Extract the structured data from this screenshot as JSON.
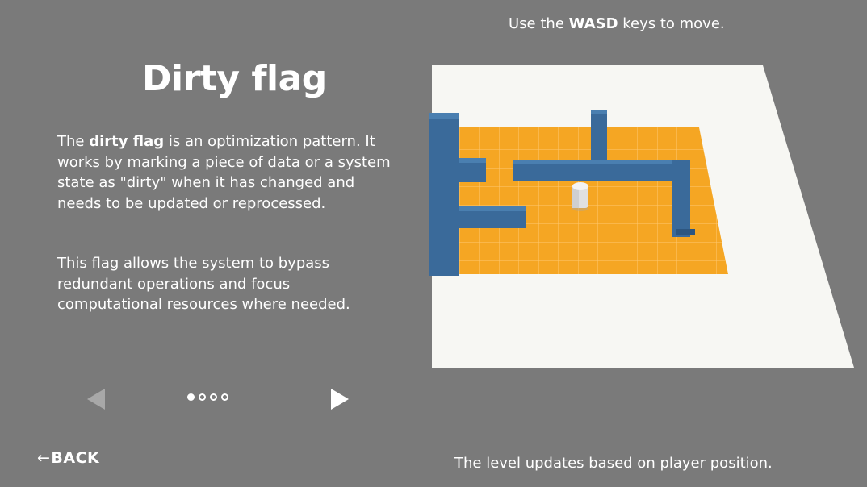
{
  "slide": {
    "title": "Dirty flag",
    "para1_prefix": "The ",
    "para1_bold": "dirty flag",
    "para1_rest": " is an optimization pattern. It works by marking a piece of data or a system state as \"dirty\" when it has changed and needs to be updated or reprocessed.",
    "para2": "This flag allows the system to bypass redundant operations and focus computational resources where needed."
  },
  "pagination": {
    "total": 4,
    "current": 1,
    "prev_icon": "triangle-left-icon",
    "next_icon": "triangle-right-icon"
  },
  "nav": {
    "back_arrow": "←",
    "back_label": "BACK"
  },
  "hints": {
    "top_prefix": "Use the ",
    "top_bold": "WASD",
    "top_suffix": " keys to move.",
    "bottom": "The level updates based on player position."
  },
  "colors": {
    "background": "#7a7a7a",
    "floor": "#ffffff",
    "grid": "#f5a623",
    "walls": "#3a6a9a",
    "player": "#e8e8e8"
  }
}
